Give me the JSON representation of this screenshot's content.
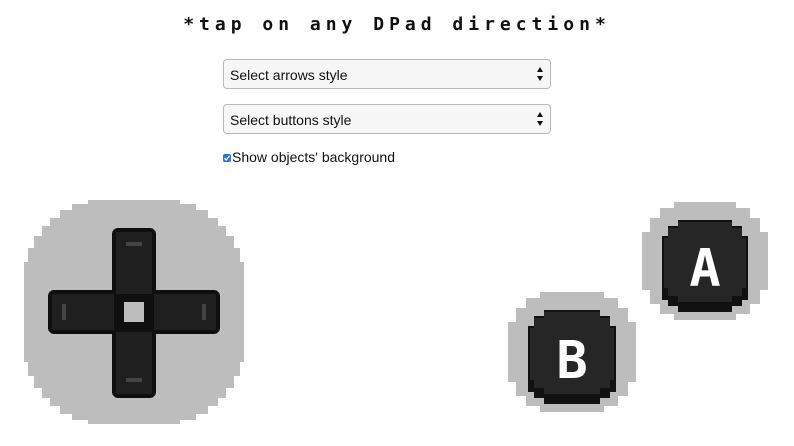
{
  "header": {
    "title": "*tap on any DPad direction*"
  },
  "controls": {
    "arrows_select": {
      "label": "Select arrows style"
    },
    "buttons_select": {
      "label": "Select buttons style"
    },
    "background_checkbox": {
      "label": "Show objects' background",
      "checked": true
    }
  },
  "gamepad": {
    "dpad": {
      "directions": [
        "up",
        "right",
        "down",
        "left"
      ]
    },
    "buttons": [
      {
        "letter": "A"
      },
      {
        "letter": "B"
      }
    ]
  },
  "colors": {
    "pad_background": "#bdbdbd",
    "pad_outline": "#9a9a9a",
    "button_face": "#222222",
    "button_shadow": "#111111",
    "letter": "#ffffff",
    "accent": "#2f6fdc"
  }
}
